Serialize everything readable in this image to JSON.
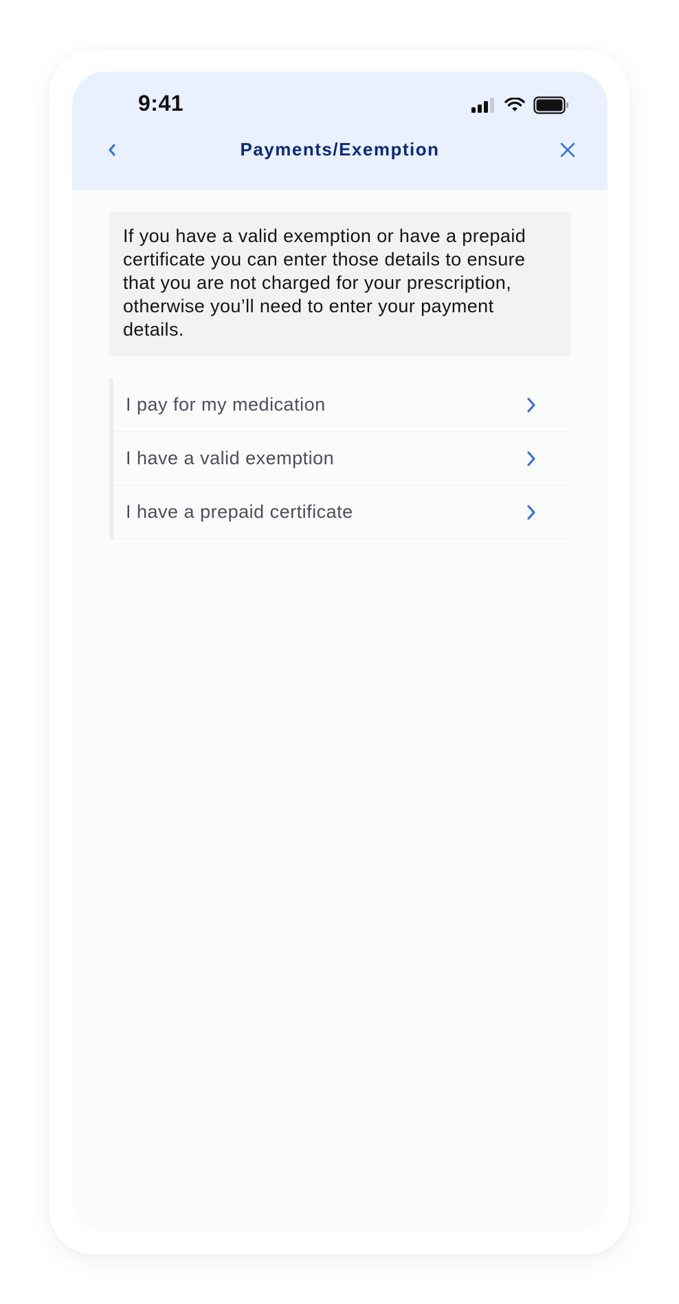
{
  "status_bar": {
    "time": "9:41",
    "signal_icon": "cellular-signal-icon",
    "wifi_icon": "wifi-icon",
    "battery_icon": "battery-icon"
  },
  "header": {
    "title": "Payments/Exemption",
    "back_icon": "chevron-left-icon",
    "close_icon": "close-icon"
  },
  "info": {
    "text": "If you have a valid exemption or have a prepaid certificate you can enter those details to ensure that you are not charged for your prescription, otherwise you’ll need to enter your payment details."
  },
  "options": [
    {
      "label": "I pay for my medication",
      "icon": "chevron-right-icon"
    },
    {
      "label": "I have a valid exemption",
      "icon": "chevron-right-icon"
    },
    {
      "label": "I have a prepaid certificate",
      "icon": "chevron-right-icon"
    }
  ],
  "colors": {
    "header_background": "#e9f0fe",
    "title": "#0c2a78",
    "accent": "#2f6fe0",
    "screen_background": "#fafbfb",
    "info_background": "#f1f2f4"
  }
}
